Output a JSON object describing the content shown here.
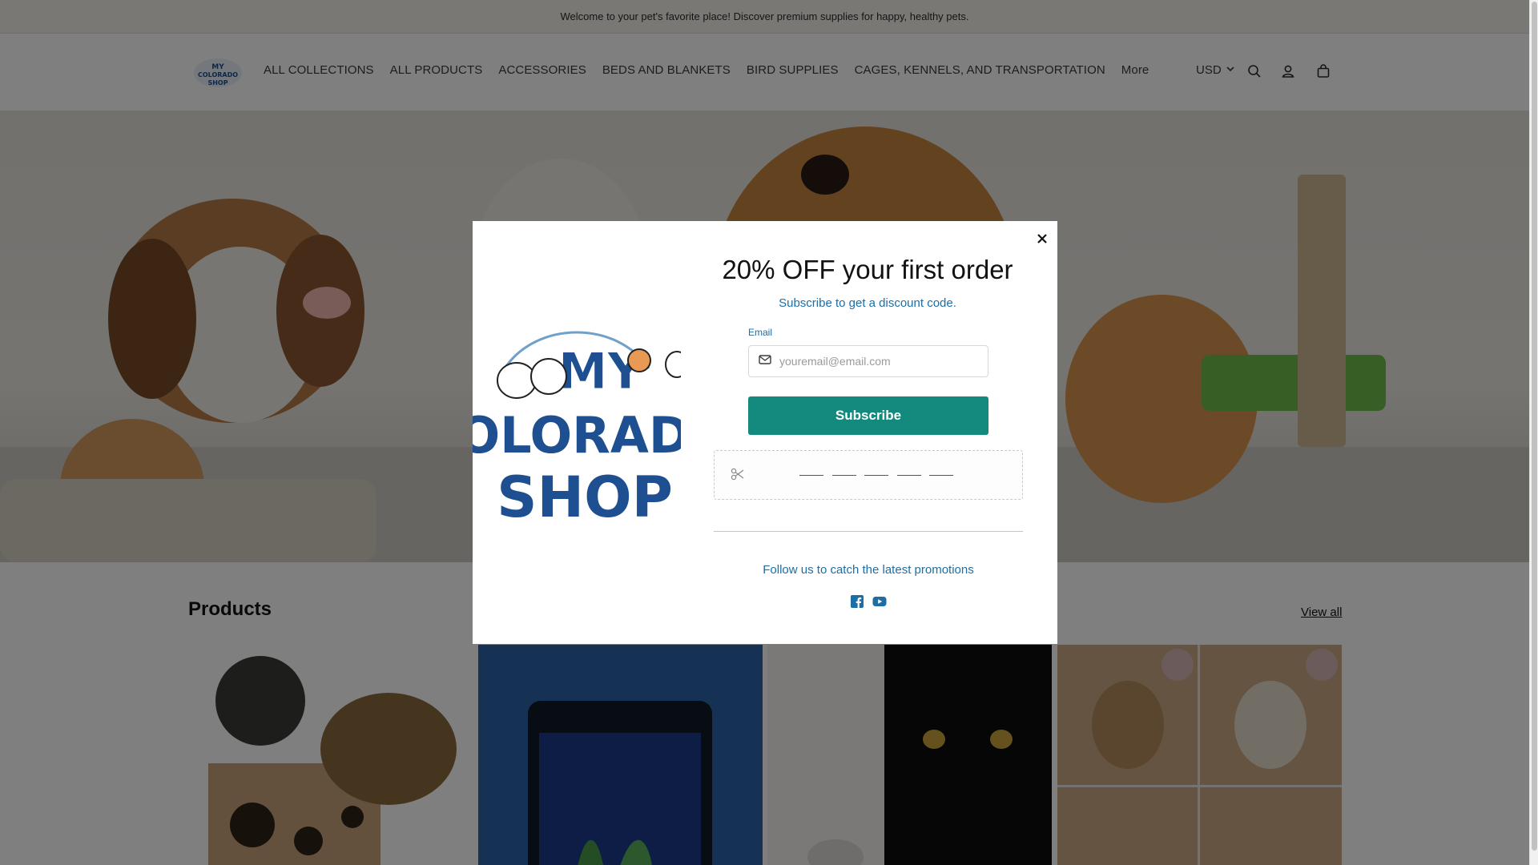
{
  "announcement": {
    "text": "Welcome to your pet's favorite place! Discover premium supplies for happy, healthy pets."
  },
  "header": {
    "logo_text": "MY COLORADO SHOP",
    "nav": [
      {
        "label": "ALL COLLECTIONS"
      },
      {
        "label": "ALL PRODUCTS"
      },
      {
        "label": "ACCESSORIES"
      },
      {
        "label": "BEDS AND BLANKETS"
      },
      {
        "label": "BIRD SUPPLIES"
      },
      {
        "label": "CAGES, KENNELS, AND TRANSPORTATION"
      },
      {
        "label": "More"
      }
    ],
    "currency": "USD",
    "icons": [
      "search-icon",
      "account-icon",
      "cart-icon"
    ]
  },
  "products": {
    "title": "Products",
    "view_all": "View all",
    "cards": [
      {
        "image": "cat-scratcher-box"
      },
      {
        "image": "aquarium-tank"
      },
      {
        "image": "black-cat-shower-curtain"
      },
      {
        "image": "plush-puppy-boxes"
      }
    ]
  },
  "popup": {
    "art_text_line1": "MY",
    "art_text_line2": "COLORADO",
    "art_text_line3": "SHOP",
    "title": "20% OFF your first order",
    "subtitle": "Subscribe to get a discount code.",
    "email_label": "Email",
    "email_placeholder": "youremail@email.com",
    "subscribe_label": "Subscribe",
    "follow_text": "Follow us to catch the latest promotions",
    "social": [
      "facebook-icon",
      "youtube-icon"
    ]
  },
  "colors": {
    "accent": "#138a7d",
    "link": "#1c6ea4",
    "announcement_bg": "#f5f0e8"
  }
}
